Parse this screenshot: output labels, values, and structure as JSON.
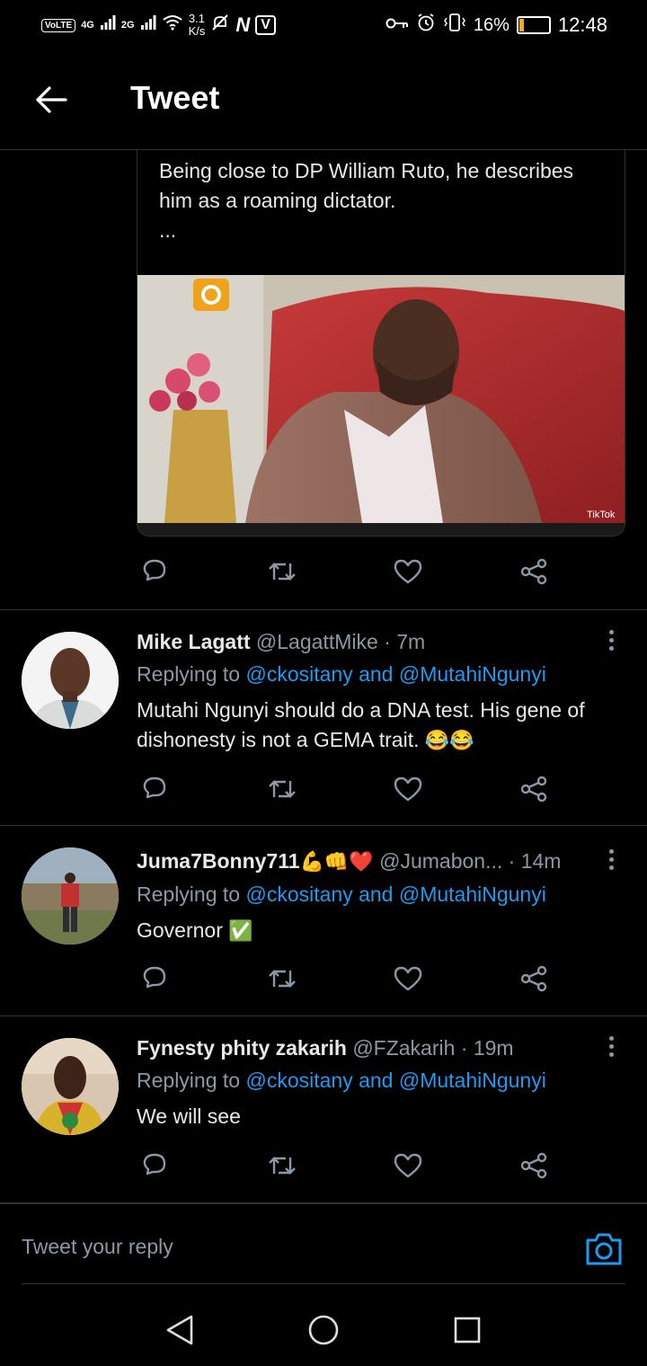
{
  "status_bar": {
    "volte": "VoLTE",
    "sig1": "4G",
    "sig2": "2G",
    "net_speed_value": "3.1",
    "net_speed_unit": "K/s",
    "app_n": "N",
    "app_v": "V",
    "battery_percent": "16%",
    "battery_level": 0.16,
    "time": "12:48"
  },
  "header": {
    "title": "Tweet"
  },
  "quoted": {
    "lines": [
      "Being close to DP William Ruto, he describes",
      "him as a roaming dictator.",
      "..."
    ],
    "media_watermark": "TikTok"
  },
  "replies": [
    {
      "name": "Mike Lagatt",
      "handle": "@LagattMike",
      "time": "· 7m",
      "replying_prefix": "Replying to",
      "mention1": "@ckositany",
      "and": "and",
      "mention2": "@MutahiNgunyi",
      "text_line1": "Mutahi Ngunyi should do a DNA test. His gene of",
      "text_line2": "dishonesty is not a GEMA trait.",
      "emoji": "😂😂"
    },
    {
      "name": "Juma7Bonny711",
      "name_emoji": "💪👊❤️",
      "handle": "@Jumabon...",
      "time": "· 14m",
      "replying_prefix": "Replying to",
      "mention1": "@ckositany",
      "and": "and",
      "mention2": "@MutahiNgunyi",
      "text": "Governor",
      "emoji": "✅"
    },
    {
      "name": "Fynesty phity zakarih",
      "handle": "@FZakarih",
      "time": "· 19m",
      "replying_prefix": "Replying to",
      "mention1": "@ckositany",
      "and": "and",
      "mention2": "@MutahiNgunyi",
      "text": "We will see"
    }
  ],
  "composer": {
    "placeholder": "Tweet your reply"
  },
  "colors": {
    "accent": "#1d9bf0",
    "muted": "#8b98a5",
    "background": "#000000",
    "divider": "#2f3336"
  },
  "icons": [
    "back-arrow-icon",
    "reply-icon",
    "retweet-icon",
    "like-icon",
    "share-icon",
    "more-icon",
    "camera-icon",
    "nav-back-icon",
    "nav-home-icon",
    "nav-recents-icon"
  ]
}
